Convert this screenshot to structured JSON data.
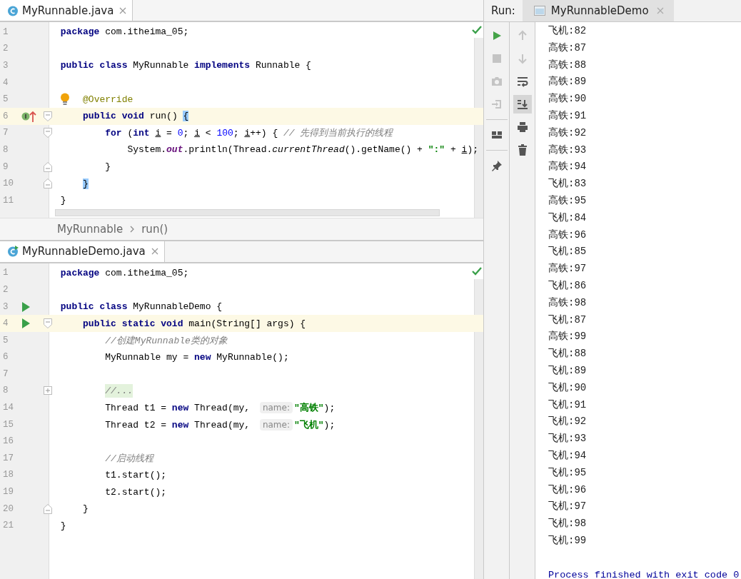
{
  "editors": [
    {
      "tab": {
        "label": "MyRunnable.java",
        "kind": "class",
        "selected": true
      },
      "lines": [
        {
          "number": "1",
          "tokens": [
            {
              "kind": "keyword",
              "text": "package"
            },
            {
              "kind": "plain",
              "text": " com.itheima_05;"
            }
          ]
        },
        {
          "number": "2"
        },
        {
          "number": "3",
          "tokens": [
            {
              "kind": "keyword",
              "text": "public class"
            },
            {
              "kind": "plain",
              "text": " MyRunnable "
            },
            {
              "kind": "keyword",
              "text": "implements"
            },
            {
              "kind": "plain",
              "text": " Runnable {"
            }
          ]
        },
        {
          "number": "4"
        },
        {
          "number": "5",
          "bulb": true,
          "tokens": [
            {
              "kind": "annotation",
              "text": "    @Override"
            }
          ]
        },
        {
          "number": "6",
          "highlighted": true,
          "gutter": {
            "kind": "implements"
          },
          "fold": {
            "kind": "open"
          },
          "tokens": [
            {
              "kind": "keyword",
              "text": "    public void"
            },
            {
              "kind": "plain",
              "text": " run() "
            },
            {
              "kind": "brace",
              "text": "{"
            }
          ]
        },
        {
          "number": "7",
          "fold": {
            "kind": "open"
          },
          "tokens": [
            {
              "kind": "keyword",
              "text": "        for"
            },
            {
              "kind": "plain",
              "text": " ("
            },
            {
              "kind": "keyword",
              "text": "int"
            },
            {
              "kind": "var",
              "text": " i"
            },
            {
              "kind": "plain",
              "text": " = "
            },
            {
              "kind": "number",
              "text": "0"
            },
            {
              "kind": "plain",
              "text": "; "
            },
            {
              "kind": "var",
              "text": "i"
            },
            {
              "kind": "plain",
              "text": " < "
            },
            {
              "kind": "number",
              "text": "100"
            },
            {
              "kind": "plain",
              "text": "; "
            },
            {
              "kind": "var",
              "text": "i"
            },
            {
              "kind": "plain",
              "text": "++) { "
            },
            {
              "kind": "comment",
              "text": "// 先得到当前执行的线程"
            }
          ]
        },
        {
          "number": "8",
          "tokens": [
            {
              "kind": "plain",
              "text": "            System."
            },
            {
              "kind": "field",
              "text": "out"
            },
            {
              "kind": "plain",
              "text": ".println(Thread."
            },
            {
              "kind": "static",
              "text": "currentThread"
            },
            {
              "kind": "plain",
              "text": "().getName() + "
            },
            {
              "kind": "string",
              "text": "\":\""
            },
            {
              "kind": "plain",
              "text": " + "
            },
            {
              "kind": "var",
              "text": "i"
            },
            {
              "kind": "plain",
              "text": ");"
            }
          ]
        },
        {
          "number": "9",
          "fold": {
            "kind": "close"
          },
          "tokens": [
            {
              "kind": "plain",
              "text": "        }"
            }
          ]
        },
        {
          "number": "10",
          "fold": {
            "kind": "close"
          },
          "tokens": [
            {
              "kind": "brace",
              "text": "    }"
            }
          ]
        },
        {
          "number": "11",
          "tokens": [
            {
              "kind": "plain",
              "text": "}"
            }
          ]
        }
      ],
      "breadcrumbs": [
        "MyRunnable",
        "run()"
      ]
    },
    {
      "tab": {
        "label": "MyRunnableDemo.java",
        "kind": "runnable",
        "selected": true
      },
      "lines": [
        {
          "number": "1",
          "tokens": [
            {
              "kind": "keyword",
              "text": "package"
            },
            {
              "kind": "plain",
              "text": " com.itheima_05;"
            }
          ]
        },
        {
          "number": "2"
        },
        {
          "number": "3",
          "gutter": {
            "kind": "run"
          },
          "tokens": [
            {
              "kind": "keyword",
              "text": "public class"
            },
            {
              "kind": "plain",
              "text": " MyRunnableDemo {"
            }
          ]
        },
        {
          "number": "4",
          "highlighted": true,
          "gutter": {
            "kind": "run"
          },
          "fold": {
            "kind": "open"
          },
          "tokens": [
            {
              "kind": "keyword",
              "text": "    public static void"
            },
            {
              "kind": "plain",
              "text": " main(String[] args) {"
            }
          ]
        },
        {
          "number": "5",
          "tokens": [
            {
              "kind": "comment",
              "text": "        //创建MyRunnable类的对象"
            }
          ]
        },
        {
          "number": "6",
          "tokens": [
            {
              "kind": "plain",
              "text": "        MyRunnable my = "
            },
            {
              "kind": "keyword",
              "text": "new"
            },
            {
              "kind": "plain",
              "text": " MyRunnable();"
            }
          ]
        },
        {
          "number": "7"
        },
        {
          "number": "8",
          "fold": {
            "kind": "collapsed"
          },
          "tokens": [
            {
              "kind": "folded",
              "text": "        //..."
            }
          ]
        },
        {
          "number": "14",
          "tokens": [
            {
              "kind": "plain",
              "text": "        Thread t1 = "
            },
            {
              "kind": "keyword",
              "text": "new"
            },
            {
              "kind": "plain",
              "text": " Thread(my, "
            },
            {
              "kind": "hint",
              "text": "name:"
            },
            {
              "kind": "string",
              "text": "\"高铁\""
            },
            {
              "kind": "plain",
              "text": ");"
            }
          ]
        },
        {
          "number": "15",
          "tokens": [
            {
              "kind": "plain",
              "text": "        Thread t2 = "
            },
            {
              "kind": "keyword",
              "text": "new"
            },
            {
              "kind": "plain",
              "text": " Thread(my, "
            },
            {
              "kind": "hint",
              "text": "name:"
            },
            {
              "kind": "string",
              "text": "\"飞机\""
            },
            {
              "kind": "plain",
              "text": ");"
            }
          ]
        },
        {
          "number": "16"
        },
        {
          "number": "17",
          "tokens": [
            {
              "kind": "comment",
              "text": "        //启动线程"
            }
          ]
        },
        {
          "number": "18",
          "tokens": [
            {
              "kind": "plain",
              "text": "        t1.start();"
            }
          ]
        },
        {
          "number": "19",
          "tokens": [
            {
              "kind": "plain",
              "text": "        t2.start();"
            }
          ]
        },
        {
          "number": "20",
          "fold": {
            "kind": "close"
          },
          "tokens": [
            {
              "kind": "plain",
              "text": "    }"
            }
          ]
        },
        {
          "number": "21",
          "tokens": [
            {
              "kind": "plain",
              "text": "}"
            }
          ]
        }
      ]
    }
  ],
  "run_panel": {
    "title": "Run:",
    "tab": {
      "label": "MyRunnableDemo",
      "selected": true
    },
    "toolbar_left": [
      {
        "kind": "run",
        "disabled": false
      },
      {
        "kind": "stop",
        "disabled": true
      },
      {
        "kind": "camera",
        "disabled": true
      },
      {
        "kind": "import",
        "disabled": true
      },
      {
        "kind": "separator"
      },
      {
        "kind": "layout",
        "disabled": false
      },
      {
        "kind": "separator"
      },
      {
        "kind": "pin",
        "disabled": false
      }
    ],
    "toolbar_right": [
      {
        "kind": "up",
        "disabled": true,
        "selected": false
      },
      {
        "kind": "down",
        "disabled": true,
        "selected": false
      },
      {
        "kind": "wrap",
        "disabled": false,
        "selected": false
      },
      {
        "kind": "scroll-end",
        "disabled": false,
        "selected": true
      },
      {
        "kind": "print",
        "disabled": false,
        "selected": false
      },
      {
        "kind": "trash",
        "disabled": false,
        "selected": false
      }
    ],
    "console": [
      {
        "kind": "output",
        "text": "飞机:82"
      },
      {
        "kind": "output",
        "text": "高铁:87"
      },
      {
        "kind": "output",
        "text": "高铁:88"
      },
      {
        "kind": "output",
        "text": "高铁:89"
      },
      {
        "kind": "output",
        "text": "高铁:90"
      },
      {
        "kind": "output",
        "text": "高铁:91"
      },
      {
        "kind": "output",
        "text": "高铁:92"
      },
      {
        "kind": "output",
        "text": "高铁:93"
      },
      {
        "kind": "output",
        "text": "高铁:94"
      },
      {
        "kind": "output",
        "text": "飞机:83"
      },
      {
        "kind": "output",
        "text": "高铁:95"
      },
      {
        "kind": "output",
        "text": "飞机:84"
      },
      {
        "kind": "output",
        "text": "高铁:96"
      },
      {
        "kind": "output",
        "text": "飞机:85"
      },
      {
        "kind": "output",
        "text": "高铁:97"
      },
      {
        "kind": "output",
        "text": "飞机:86"
      },
      {
        "kind": "output",
        "text": "高铁:98"
      },
      {
        "kind": "output",
        "text": "飞机:87"
      },
      {
        "kind": "output",
        "text": "高铁:99"
      },
      {
        "kind": "output",
        "text": "飞机:88"
      },
      {
        "kind": "output",
        "text": "飞机:89"
      },
      {
        "kind": "output",
        "text": "飞机:90"
      },
      {
        "kind": "output",
        "text": "飞机:91"
      },
      {
        "kind": "output",
        "text": "飞机:92"
      },
      {
        "kind": "output",
        "text": "飞机:93"
      },
      {
        "kind": "output",
        "text": "飞机:94"
      },
      {
        "kind": "output",
        "text": "飞机:95"
      },
      {
        "kind": "output",
        "text": "飞机:96"
      },
      {
        "kind": "output",
        "text": "飞机:97"
      },
      {
        "kind": "output",
        "text": "飞机:98"
      },
      {
        "kind": "output",
        "text": "飞机:99"
      },
      {
        "kind": "blank"
      },
      {
        "kind": "system",
        "text": "Process finished with exit code 0"
      }
    ]
  }
}
